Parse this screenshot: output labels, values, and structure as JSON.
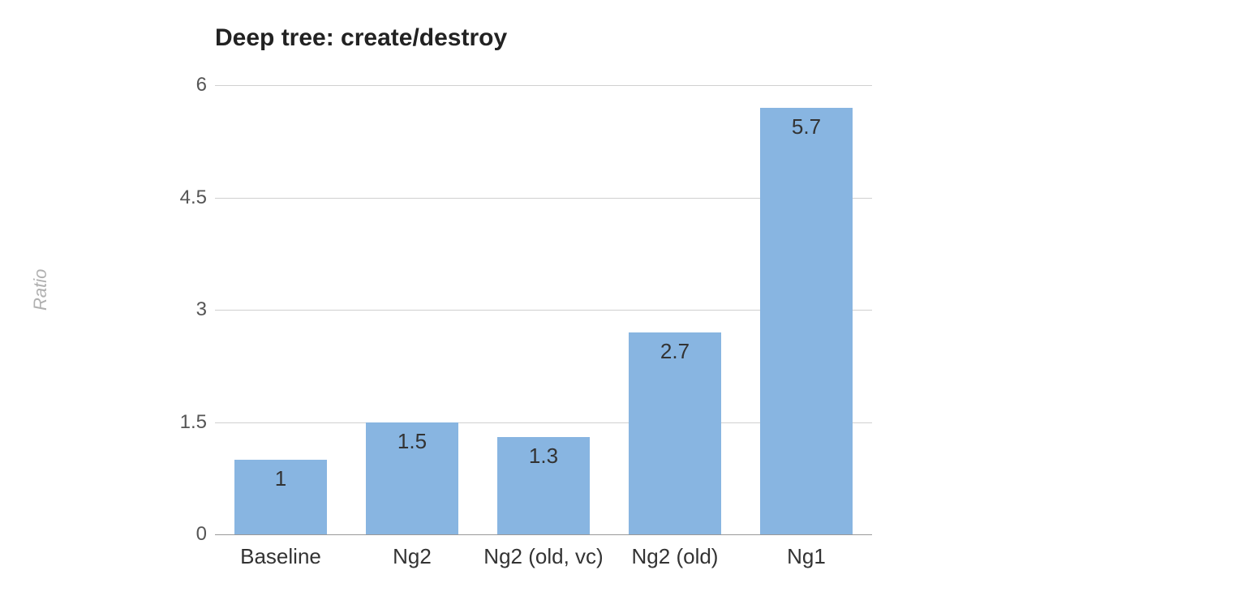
{
  "chart_data": {
    "type": "bar",
    "title": "Deep tree: create/destroy",
    "ylabel": "Ratio",
    "xlabel": "",
    "ylim": [
      0,
      6
    ],
    "y_ticks": [
      0,
      1.5,
      3,
      4.5,
      6
    ],
    "categories": [
      "Baseline",
      "Ng2",
      "Ng2 (old, vc)",
      "Ng2 (old)",
      "Ng1"
    ],
    "values": [
      1,
      1.5,
      1.3,
      2.7,
      5.7
    ],
    "bar_color": "#88b5e1"
  }
}
